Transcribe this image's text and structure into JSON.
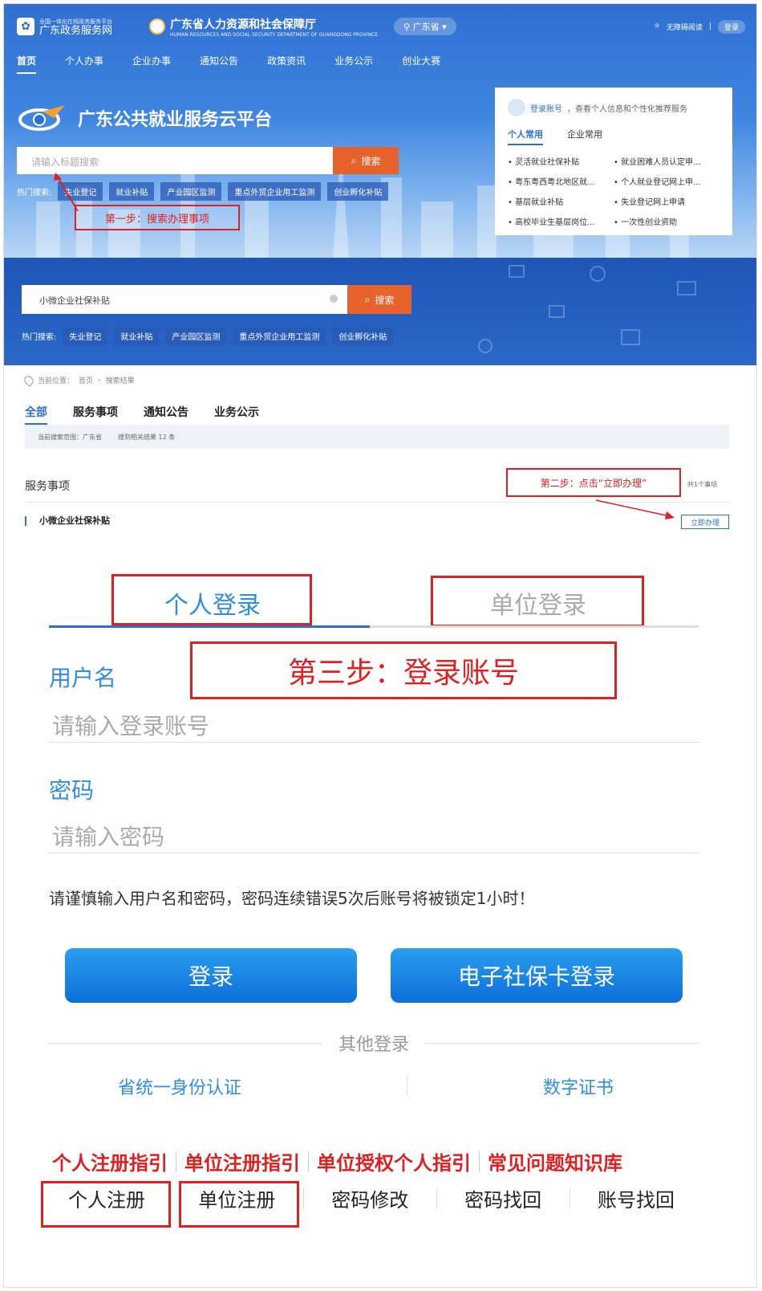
{
  "header": {
    "portal_sub": "全国一体化在线政务服务平台",
    "portal_name": "广东政务服务网",
    "dept_name": "广东省人力资源和社会保障厅",
    "dept_sub": "HUMAN RESOURCES AND SOCIAL SECURITY DEPARTMENT OF GUANGDONG PROVINCE",
    "region": "广东省",
    "accessibility": "无障碍阅读",
    "login": "登录"
  },
  "nav": [
    "首页",
    "个人办事",
    "企业办事",
    "通知公告",
    "政策资讯",
    "业务公示",
    "创业大赛"
  ],
  "brand": {
    "title": "广东公共就业服务云平台"
  },
  "search1": {
    "placeholder": "请输入标题搜索",
    "button": "搜索"
  },
  "hot": {
    "label": "热门搜索:",
    "tags": [
      "失业登记",
      "就业补贴",
      "产业园区监测",
      "重点外贸企业用工监测",
      "创业孵化补贴"
    ]
  },
  "annotations": {
    "step1": "第一步：搜索办理事项",
    "step2": "第二步：点击“立即办理”",
    "step3": "第三步：登录账号"
  },
  "panel": {
    "account_link": "登录账号",
    "account_text": "，查看个人信息和个性化推荐服务",
    "tabs": [
      "个人常用",
      "企业常用"
    ],
    "items": [
      "灵活就业社保补贴",
      "就业困难人员认定申...",
      "粤东粤西粤北地区就...",
      "个人就业登记网上申...",
      "基层就业补贴",
      "失业登记网上申请",
      "高校毕业生基层岗位...",
      "一次性创业资助"
    ]
  },
  "search2": {
    "value": "小微企业社保补贴",
    "button": "搜索"
  },
  "results": {
    "crumb_label": "当前位置：",
    "crumb_home": "首页",
    "crumb_current": "搜索结果",
    "tabs": [
      "全部",
      "服务事项",
      "通知公告",
      "业务公示"
    ],
    "scope": "当前搜索范围：广东省",
    "count": "搜到相关结果 12 条",
    "section": "服务事项",
    "section_count": "共1个事项",
    "item": "小微企业社保补贴",
    "handle": "立即办理"
  },
  "login": {
    "tab_personal": "个人登录",
    "tab_unit": "单位登录",
    "username_label": "用户名",
    "username_placeholder": "请输入登录账号",
    "password_label": "密码",
    "password_placeholder": "请输入密码",
    "warning": "请谨慎输入用户名和密码，密码连续错误5次后账号将被锁定1小时！",
    "btn_login": "登录",
    "btn_card": "电子社保卡登录",
    "other": "其他登录",
    "alt1": "省统一身份认证",
    "alt2": "数字证书",
    "guides": [
      "个人注册指引",
      "单位注册指引",
      "单位授权个人指引",
      "常见问题知识库"
    ],
    "actions": [
      "个人注册",
      "单位注册",
      "密码修改",
      "密码找回",
      "账号找回"
    ]
  },
  "colors": {
    "primary": "#2f6fd1",
    "accent": "#e8622c",
    "annotation": "#e02020"
  }
}
